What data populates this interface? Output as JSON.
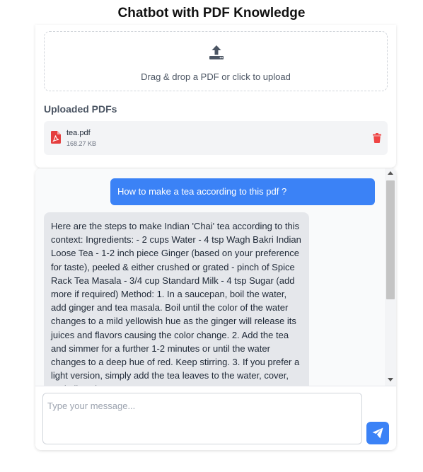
{
  "header": {
    "title": "Chatbot with PDF Knowledge"
  },
  "upload": {
    "dropzone_text": "Drag & drop a PDF or click to upload",
    "uploaded_heading": "Uploaded PDFs",
    "files": [
      {
        "name": "tea.pdf",
        "size": "168.27 KB"
      }
    ]
  },
  "chat": {
    "messages": [
      {
        "role": "user",
        "text": "How to make a tea according to this pdf ?"
      },
      {
        "role": "bot",
        "text": "Here are the steps to make Indian 'Chai' tea according to this context: Ingredients: - 2 cups Water - 4 tsp Wagh Bakri Indian Loose Tea - 1-2 inch piece Ginger (based on your preference for taste), peeled & either crushed or grated - pinch of Spice Rack Tea Masala - 3/4 cup Standard Milk - 4 tsp Sugar (add more if required) Method: 1. In a saucepan, boil the water, add ginger and tea masala. Boil until the color of the water changes to a mild yellowish hue as the ginger will release its juices and flavors causing the color change. 2. Add the tea and simmer for a further 1-2 minutes or until the water changes to a deep hue of red. Keep stirring. 3. If you prefer a light version, simply add the tea leaves to the water, cover, and allow the tea"
      }
    ],
    "input_placeholder": "Type your message...",
    "input_value": ""
  },
  "icons": {
    "upload": "upload-icon",
    "pdf": "pdf-file-icon",
    "delete": "trash-icon",
    "send": "paper-plane-icon"
  },
  "colors": {
    "accent": "#3b82f6",
    "delete": "#ef4444",
    "pdf": "#e53e3e",
    "upload_icon": "#4b5563",
    "bot_bubble": "#e5e7eb"
  }
}
